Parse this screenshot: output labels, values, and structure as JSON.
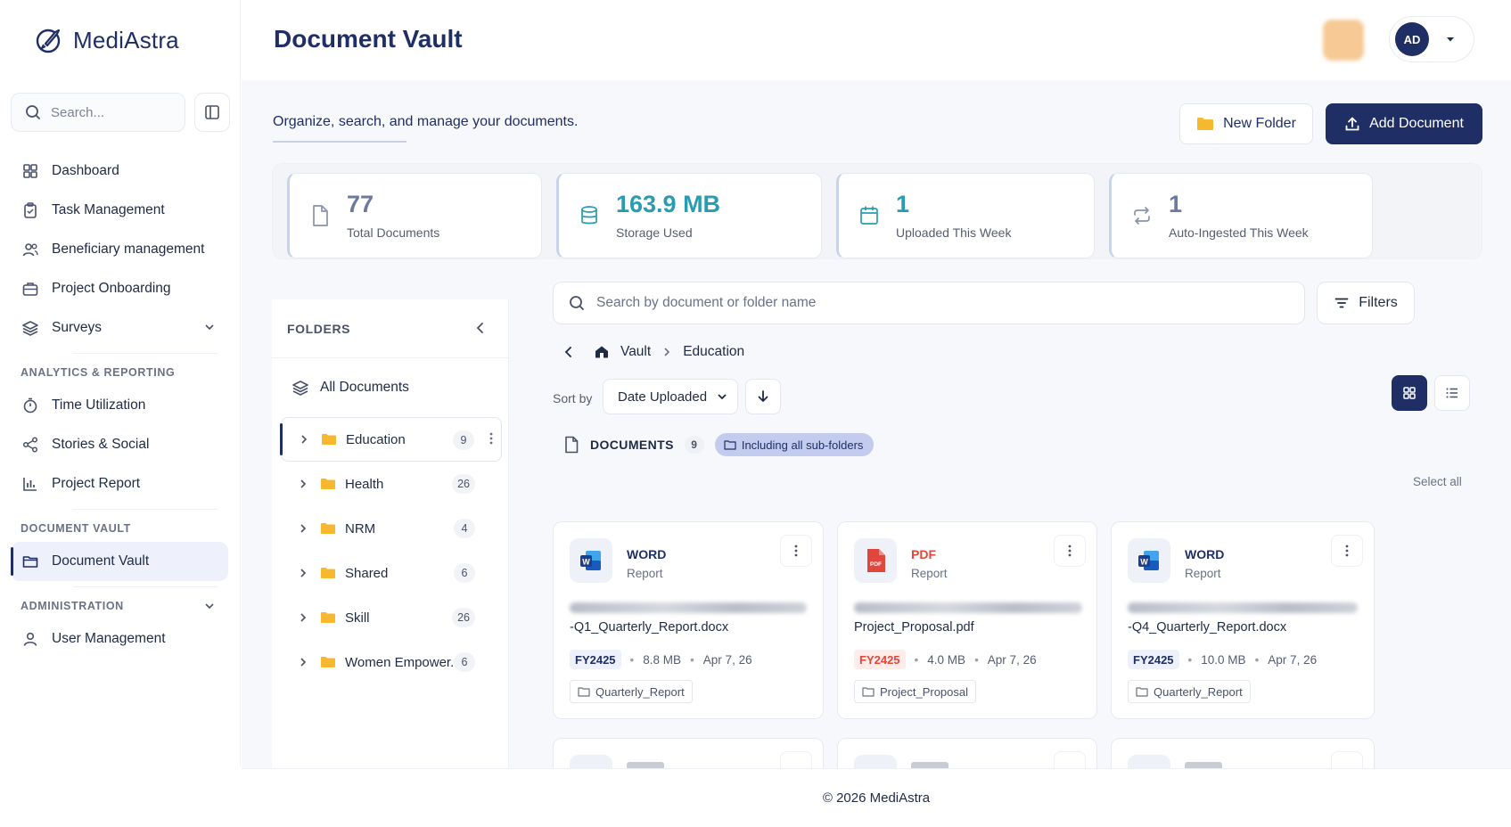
{
  "brand": {
    "name": "MediAstra"
  },
  "header": {
    "title": "Document Vault",
    "user_initials": "AD"
  },
  "sidebar": {
    "search_placeholder": "Search...",
    "primary": [
      {
        "label": "Dashboard"
      },
      {
        "label": "Task Management"
      },
      {
        "label": "Beneficiary management"
      },
      {
        "label": "Project Onboarding"
      },
      {
        "label": "Surveys"
      }
    ],
    "analytics_heading": "ANALYTICS & REPORTING",
    "analytics": [
      {
        "label": "Time Utilization"
      },
      {
        "label": "Stories & Social"
      },
      {
        "label": "Project Report"
      }
    ],
    "vault_heading": "DOCUMENT VAULT",
    "vault": [
      {
        "label": "Document Vault"
      }
    ],
    "admin_heading": "ADMINISTRATION",
    "admin": [
      {
        "label": "User Management"
      }
    ]
  },
  "main": {
    "subtitle": "Organize, search, and manage your documents.",
    "new_folder_label": "New Folder",
    "add_document_label": "Add Document"
  },
  "stats": [
    {
      "value": "77",
      "label": "Total Documents",
      "color": "#6b7a9e"
    },
    {
      "value": "163.9 MB",
      "label": "Storage Used",
      "color": "#2a9cb0"
    },
    {
      "value": "1",
      "label": "Uploaded This Week",
      "color": "#2a9cb0"
    },
    {
      "value": "1",
      "label": "Auto-Ingested This Week",
      "color": "#6b7a9e"
    }
  ],
  "folders": {
    "heading": "FOLDERS",
    "all_label": "All Documents",
    "items": [
      {
        "name": "Education",
        "count": "9"
      },
      {
        "name": "Health",
        "count": "26"
      },
      {
        "name": "NRM",
        "count": "4"
      },
      {
        "name": "Shared",
        "count": "6"
      },
      {
        "name": "Skill",
        "count": "26"
      },
      {
        "name": "Women Empower...",
        "count": "6"
      }
    ]
  },
  "documents": {
    "search_placeholder": "Search by document or folder name",
    "filters_label": "Filters",
    "breadcrumb": {
      "root": "Vault",
      "current": "Education"
    },
    "sort_label": "Sort by",
    "sort_value": "Date Uploaded",
    "heading": "DOCUMENTS",
    "count": "9",
    "subfolder_pill": "Including all sub-folders",
    "select_all": "Select all",
    "cards": [
      {
        "type": "WORD",
        "category": "Report",
        "filename": "-Q1_Quarterly_Report.docx",
        "fy": "FY2425",
        "size": "8.8 MB",
        "date": "Apr 7, 26",
        "tag": "Quarterly_Report"
      },
      {
        "type": "PDF",
        "category": "Report",
        "filename": "Project_Proposal.pdf",
        "fy": "FY2425",
        "size": "4.0 MB",
        "date": "Apr 7, 26",
        "tag": "Project_Proposal"
      },
      {
        "type": "WORD",
        "category": "Report",
        "filename": "-Q4_Quarterly_Report.docx",
        "fy": "FY2425",
        "size": "10.0 MB",
        "date": "Apr 7, 26",
        "tag": "Quarterly_Report"
      }
    ]
  },
  "colors": {
    "primary": "#1f2f66",
    "word": "#1f2f66",
    "pdf": "#e0463b",
    "accent": "#2a9cb0"
  },
  "footer": {
    "text": "© 2026 MediAstra"
  }
}
